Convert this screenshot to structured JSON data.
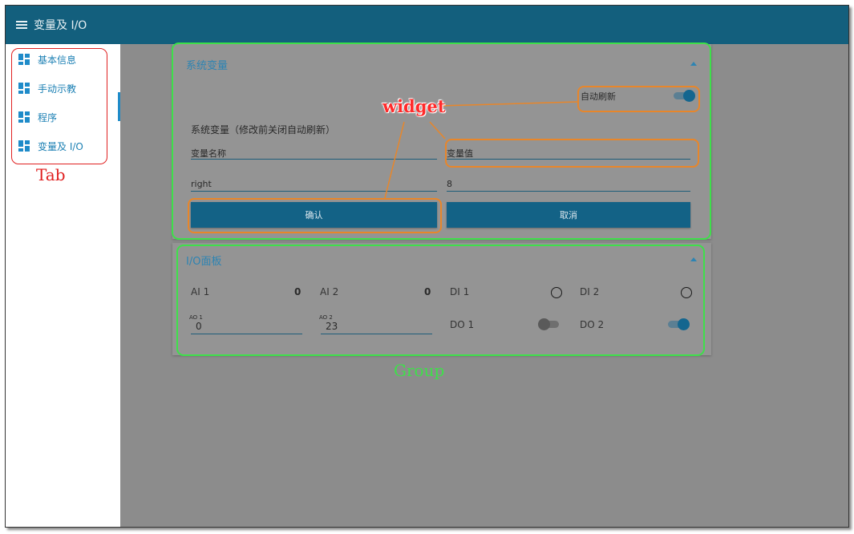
{
  "topbar": {
    "title": "变量及 I/O"
  },
  "sidebar": {
    "items": [
      {
        "label": "基本信息"
      },
      {
        "label": "手动示教"
      },
      {
        "label": "程序"
      },
      {
        "label": "变量及 I/O"
      }
    ]
  },
  "system_panel": {
    "title": "系统变量",
    "auto_refresh_label": "自动刷新",
    "auto_refresh_on": true,
    "section_label": "系统变量（修改前关闭自动刷新）",
    "var_name_label": "变量名称",
    "var_value_label": "变量值",
    "var_name_value": "right",
    "var_value_value": "8",
    "confirm_label": "确认",
    "cancel_label": "取消"
  },
  "io_panel": {
    "title": "I/O面板",
    "ai1_label": "AI 1",
    "ai1_value": "0",
    "ai2_label": "AI 2",
    "ai2_value": "0",
    "di1_label": "DI 1",
    "di2_label": "DI 2",
    "ao1_label": "AO 1",
    "ao1_value": "0",
    "ao2_label": "AO 2",
    "ao2_value": "23",
    "do1_label": "DO 1",
    "do1_on": false,
    "do2_label": "DO 2",
    "do2_on": true
  },
  "annotations": {
    "tab_label": "Tab",
    "widget_label": "widget",
    "group_label": "Group"
  },
  "colors": {
    "topbar": "#135f7d",
    "accent": "#1f8bc9",
    "button": "#136286",
    "main_bg": "#8c8c8c",
    "annotation_red": "#e02020",
    "annotation_green": "#3ee04a",
    "annotation_orange": "#e8862a"
  }
}
